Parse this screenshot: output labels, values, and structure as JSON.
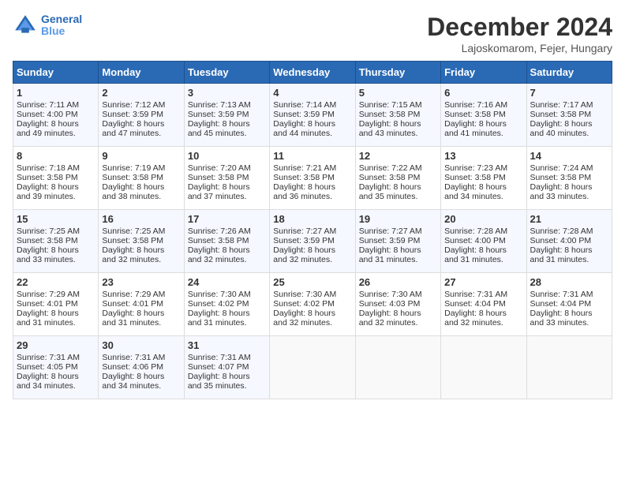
{
  "header": {
    "logo_line1": "General",
    "logo_line2": "Blue",
    "month": "December 2024",
    "location": "Lajoskomarom, Fejer, Hungary"
  },
  "days_of_week": [
    "Sunday",
    "Monday",
    "Tuesday",
    "Wednesday",
    "Thursday",
    "Friday",
    "Saturday"
  ],
  "weeks": [
    [
      {
        "day": "1",
        "info": "Sunrise: 7:11 AM\nSunset: 4:00 PM\nDaylight: 8 hours\nand 49 minutes."
      },
      {
        "day": "2",
        "info": "Sunrise: 7:12 AM\nSunset: 3:59 PM\nDaylight: 8 hours\nand 47 minutes."
      },
      {
        "day": "3",
        "info": "Sunrise: 7:13 AM\nSunset: 3:59 PM\nDaylight: 8 hours\nand 45 minutes."
      },
      {
        "day": "4",
        "info": "Sunrise: 7:14 AM\nSunset: 3:59 PM\nDaylight: 8 hours\nand 44 minutes."
      },
      {
        "day": "5",
        "info": "Sunrise: 7:15 AM\nSunset: 3:58 PM\nDaylight: 8 hours\nand 43 minutes."
      },
      {
        "day": "6",
        "info": "Sunrise: 7:16 AM\nSunset: 3:58 PM\nDaylight: 8 hours\nand 41 minutes."
      },
      {
        "day": "7",
        "info": "Sunrise: 7:17 AM\nSunset: 3:58 PM\nDaylight: 8 hours\nand 40 minutes."
      }
    ],
    [
      {
        "day": "8",
        "info": "Sunrise: 7:18 AM\nSunset: 3:58 PM\nDaylight: 8 hours\nand 39 minutes."
      },
      {
        "day": "9",
        "info": "Sunrise: 7:19 AM\nSunset: 3:58 PM\nDaylight: 8 hours\nand 38 minutes."
      },
      {
        "day": "10",
        "info": "Sunrise: 7:20 AM\nSunset: 3:58 PM\nDaylight: 8 hours\nand 37 minutes."
      },
      {
        "day": "11",
        "info": "Sunrise: 7:21 AM\nSunset: 3:58 PM\nDaylight: 8 hours\nand 36 minutes."
      },
      {
        "day": "12",
        "info": "Sunrise: 7:22 AM\nSunset: 3:58 PM\nDaylight: 8 hours\nand 35 minutes."
      },
      {
        "day": "13",
        "info": "Sunrise: 7:23 AM\nSunset: 3:58 PM\nDaylight: 8 hours\nand 34 minutes."
      },
      {
        "day": "14",
        "info": "Sunrise: 7:24 AM\nSunset: 3:58 PM\nDaylight: 8 hours\nand 33 minutes."
      }
    ],
    [
      {
        "day": "15",
        "info": "Sunrise: 7:25 AM\nSunset: 3:58 PM\nDaylight: 8 hours\nand 33 minutes."
      },
      {
        "day": "16",
        "info": "Sunrise: 7:25 AM\nSunset: 3:58 PM\nDaylight: 8 hours\nand 32 minutes."
      },
      {
        "day": "17",
        "info": "Sunrise: 7:26 AM\nSunset: 3:58 PM\nDaylight: 8 hours\nand 32 minutes."
      },
      {
        "day": "18",
        "info": "Sunrise: 7:27 AM\nSunset: 3:59 PM\nDaylight: 8 hours\nand 32 minutes."
      },
      {
        "day": "19",
        "info": "Sunrise: 7:27 AM\nSunset: 3:59 PM\nDaylight: 8 hours\nand 31 minutes."
      },
      {
        "day": "20",
        "info": "Sunrise: 7:28 AM\nSunset: 4:00 PM\nDaylight: 8 hours\nand 31 minutes."
      },
      {
        "day": "21",
        "info": "Sunrise: 7:28 AM\nSunset: 4:00 PM\nDaylight: 8 hours\nand 31 minutes."
      }
    ],
    [
      {
        "day": "22",
        "info": "Sunrise: 7:29 AM\nSunset: 4:01 PM\nDaylight: 8 hours\nand 31 minutes."
      },
      {
        "day": "23",
        "info": "Sunrise: 7:29 AM\nSunset: 4:01 PM\nDaylight: 8 hours\nand 31 minutes."
      },
      {
        "day": "24",
        "info": "Sunrise: 7:30 AM\nSunset: 4:02 PM\nDaylight: 8 hours\nand 31 minutes."
      },
      {
        "day": "25",
        "info": "Sunrise: 7:30 AM\nSunset: 4:02 PM\nDaylight: 8 hours\nand 32 minutes."
      },
      {
        "day": "26",
        "info": "Sunrise: 7:30 AM\nSunset: 4:03 PM\nDaylight: 8 hours\nand 32 minutes."
      },
      {
        "day": "27",
        "info": "Sunrise: 7:31 AM\nSunset: 4:04 PM\nDaylight: 8 hours\nand 32 minutes."
      },
      {
        "day": "28",
        "info": "Sunrise: 7:31 AM\nSunset: 4:04 PM\nDaylight: 8 hours\nand 33 minutes."
      }
    ],
    [
      {
        "day": "29",
        "info": "Sunrise: 7:31 AM\nSunset: 4:05 PM\nDaylight: 8 hours\nand 34 minutes."
      },
      {
        "day": "30",
        "info": "Sunrise: 7:31 AM\nSunset: 4:06 PM\nDaylight: 8 hours\nand 34 minutes."
      },
      {
        "day": "31",
        "info": "Sunrise: 7:31 AM\nSunset: 4:07 PM\nDaylight: 8 hours\nand 35 minutes."
      },
      {
        "day": "",
        "info": ""
      },
      {
        "day": "",
        "info": ""
      },
      {
        "day": "",
        "info": ""
      },
      {
        "day": "",
        "info": ""
      }
    ]
  ]
}
